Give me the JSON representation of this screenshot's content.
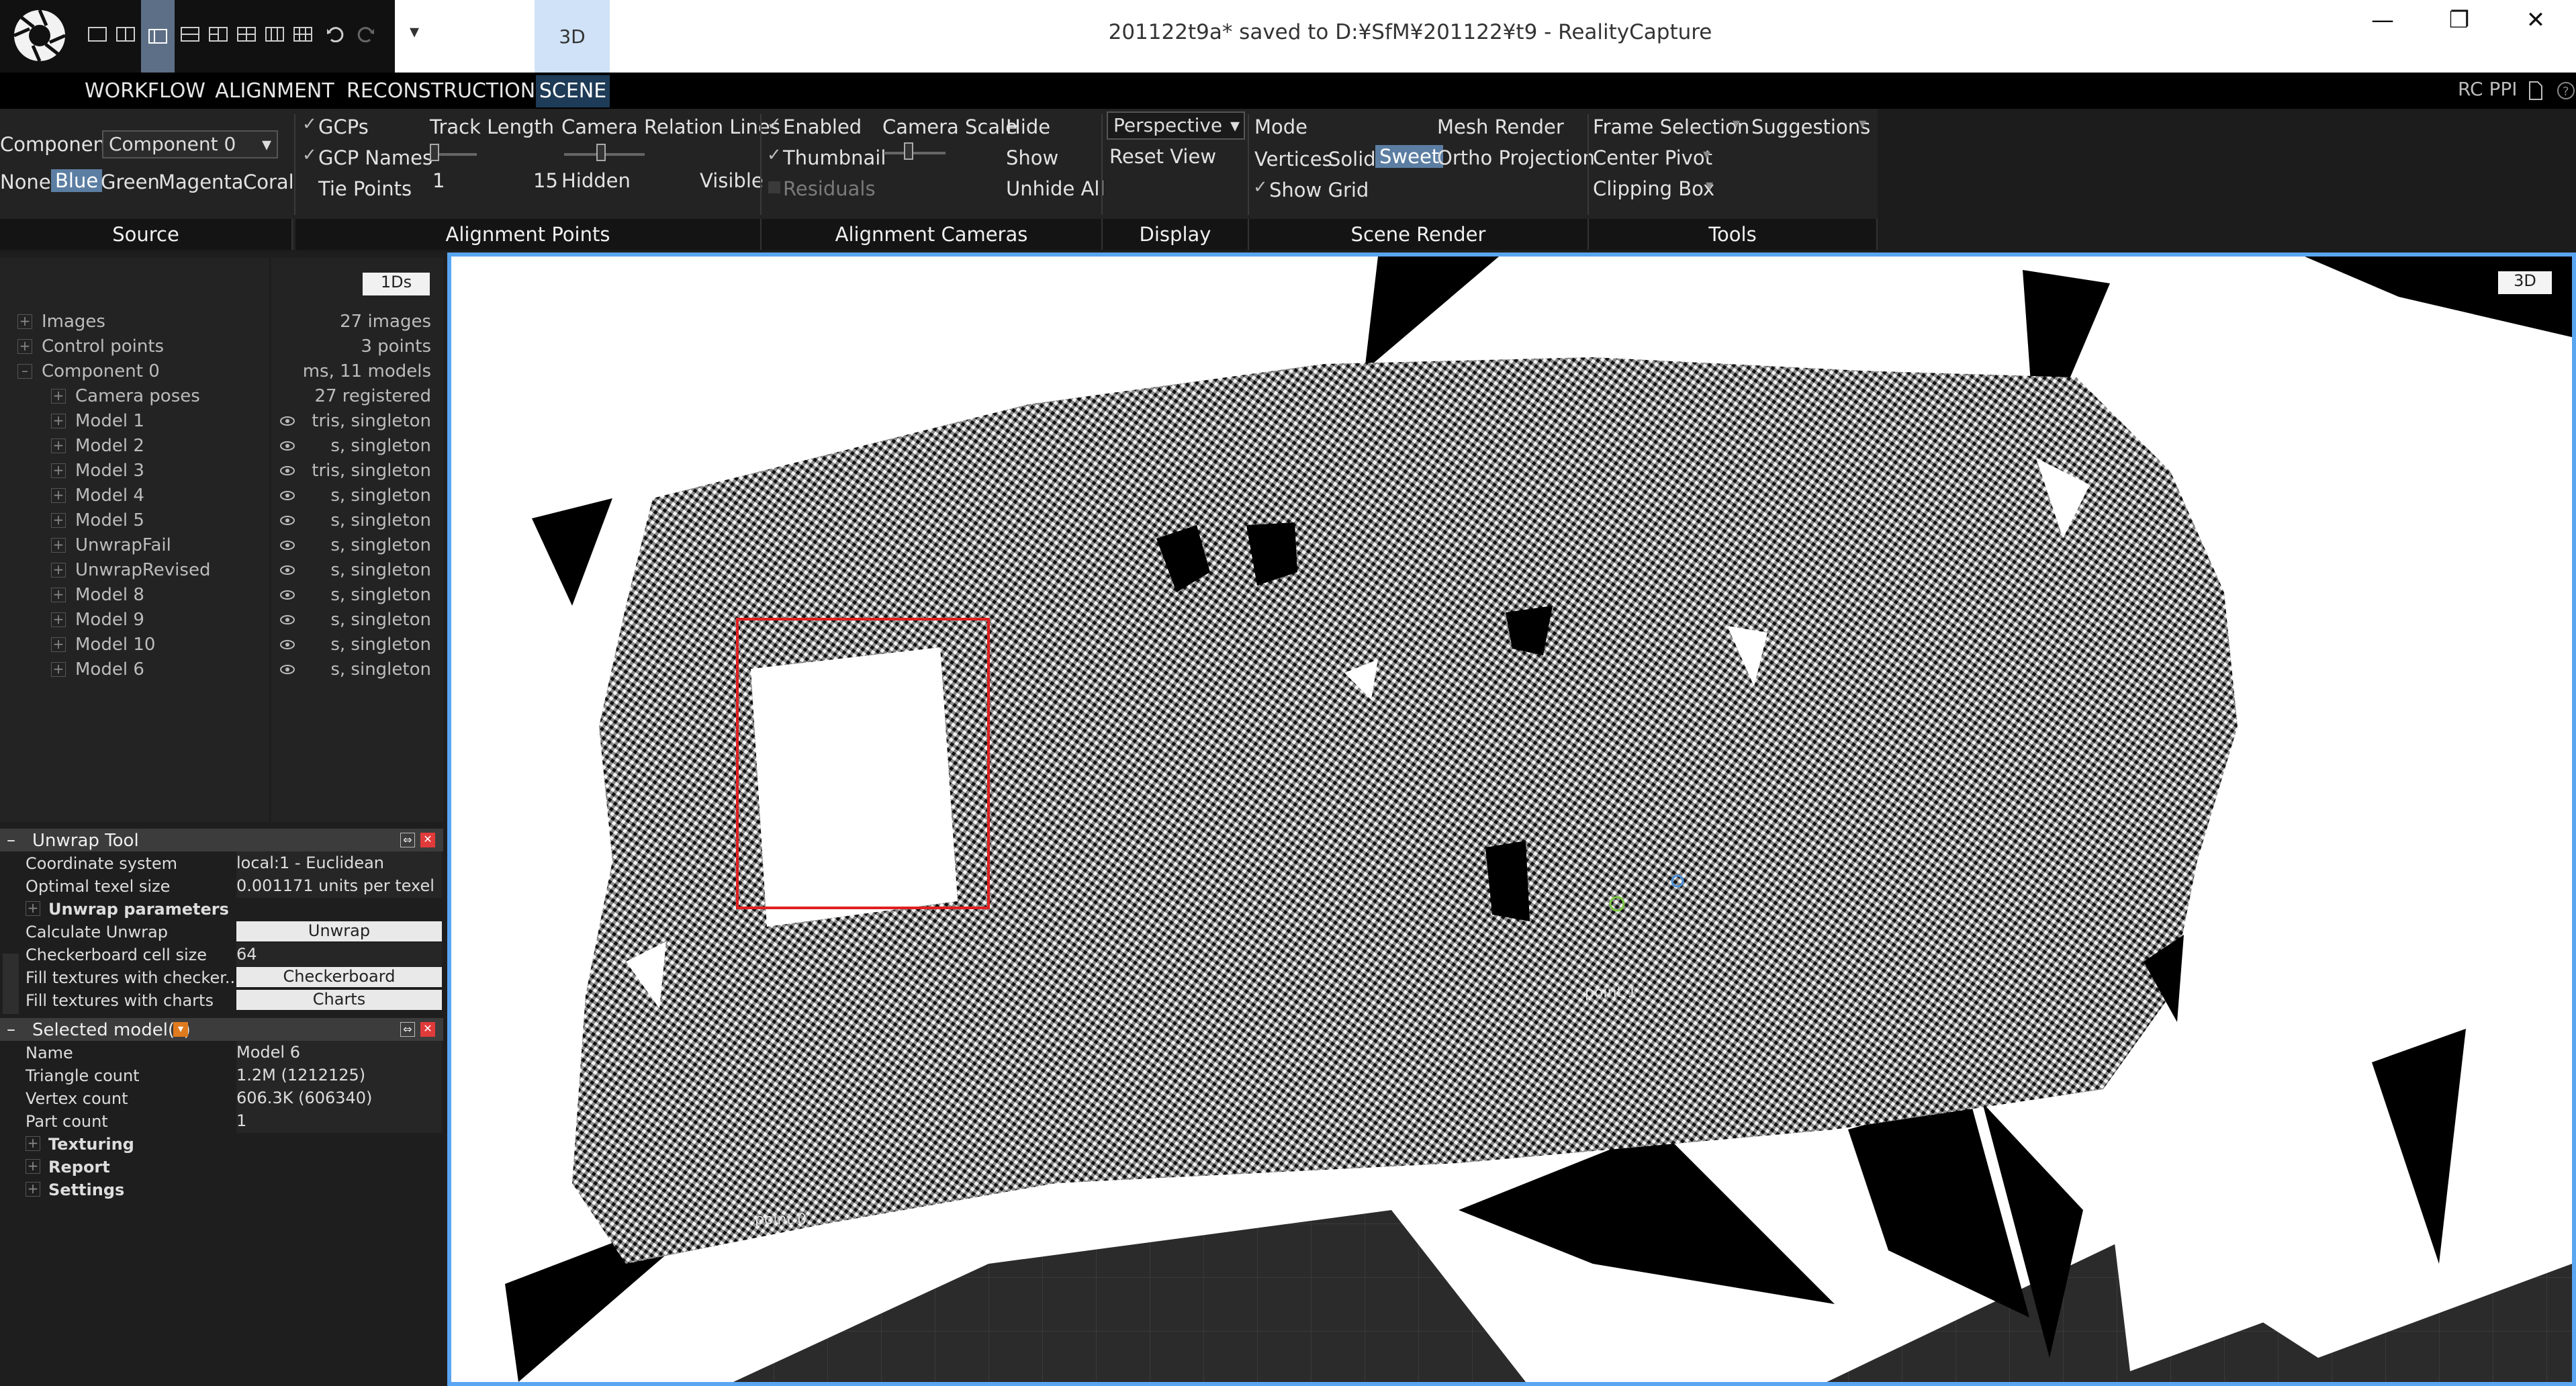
{
  "window": {
    "title": "201122t9a* saved to D:¥SfM¥201122¥t9 - RealityCapture",
    "mode_button": "3D",
    "minimize": "—",
    "maximize": "❐",
    "close": "✕"
  },
  "menu": {
    "tabs": [
      "WORKFLOW",
      "ALIGNMENT",
      "RECONSTRUCTION",
      "SCENE"
    ],
    "active": "SCENE",
    "right_label": "RC PPI"
  },
  "ribbon": {
    "source": {
      "component_label": "Component",
      "component_value": "Component 0",
      "colors": [
        "None",
        "Blue",
        "Green",
        "Magenta",
        "Coral"
      ],
      "selected_color": "Blue",
      "section": "Source"
    },
    "alignment_points": {
      "gcps": "GCPs",
      "gcp_names": "GCP Names",
      "tie_points": "Tie Points",
      "track_length": "Track Length",
      "track_min": "1",
      "track_max": "15",
      "camera_relation_lines": "Camera Relation Lines",
      "hidden": "Hidden",
      "visible": "Visible",
      "section": "Alignment Points"
    },
    "alignment_cameras": {
      "enabled": "Enabled",
      "thumbnail": "Thumbnail",
      "residuals": "Residuals",
      "camera_scale": "Camera Scale",
      "hide": "Hide",
      "show": "Show",
      "unhide_all": "Unhide All",
      "section": "Alignment Cameras"
    },
    "display": {
      "projection": "Perspective",
      "reset_view": "Reset View",
      "section": "Display"
    },
    "scene_render": {
      "mode": "Mode",
      "vertices": "Vertices",
      "solid": "Solid",
      "sweet": "Sweet",
      "mesh_render": "Mesh Render",
      "ortho_projection": "Ortho Projection",
      "show_grid": "Show Grid",
      "section": "Scene Render"
    },
    "tools": {
      "frame_selection": "Frame Selection",
      "suggestions": "Suggestions",
      "center_pivot": "Center Pivot",
      "clipping_box": "Clipping Box",
      "section": "Tools"
    }
  },
  "tree": {
    "view_button": "1Ds",
    "items": [
      {
        "label": "Images",
        "info": "27 images"
      },
      {
        "label": "Control points",
        "info": "3 points"
      },
      {
        "label": "Component 0",
        "info": "ms, 11 models"
      },
      {
        "label": "Camera poses",
        "info": "27 registered"
      },
      {
        "label": "Model 1",
        "info": "tris, singleton"
      },
      {
        "label": "Model 2",
        "info": "s, singleton"
      },
      {
        "label": "Model 3",
        "info": "tris, singleton"
      },
      {
        "label": "Model 4",
        "info": "s, singleton"
      },
      {
        "label": "Model 5",
        "info": "s, singleton"
      },
      {
        "label": "UnwrapFail",
        "info": "s, singleton"
      },
      {
        "label": "UnwrapRevised",
        "info": "s, singleton"
      },
      {
        "label": "Model 8",
        "info": "s, singleton"
      },
      {
        "label": "Model 9",
        "info": "s, singleton"
      },
      {
        "label": "Model 10",
        "info": "s, singleton"
      },
      {
        "label": "Model 6",
        "info": "s, singleton"
      }
    ]
  },
  "unwrap_tool": {
    "title": "Unwrap Tool",
    "coordinate_system_label": "Coordinate system",
    "coordinate_system_value": "local:1 - Euclidean",
    "optimal_texel_label": "Optimal texel size",
    "optimal_texel_value": "0.001171 units per texel",
    "params_header": "Unwrap parameters",
    "calculate_label": "Calculate Unwrap",
    "calculate_button": "Unwrap",
    "checker_cell_label": "Checkerboard cell size",
    "checker_cell_value": "64",
    "fill_checker_label": "Fill textures with checker...",
    "fill_checker_button": "Checkerboard",
    "fill_charts_label": "Fill textures with charts",
    "fill_charts_button": "Charts"
  },
  "selected_models": {
    "title": "Selected model(s)",
    "name_label": "Name",
    "name_value": "Model 6",
    "triangle_label": "Triangle count",
    "triangle_value": "1.2M (1212125)",
    "vertex_label": "Vertex count",
    "vertex_value": "606.3K (606340)",
    "part_label": "Part count",
    "part_value": "1",
    "texturing": "Texturing",
    "report": "Report",
    "settings": "Settings"
  },
  "viewport": {
    "view_button": "3D",
    "labels": [
      "point 0",
      "point 1"
    ]
  }
}
